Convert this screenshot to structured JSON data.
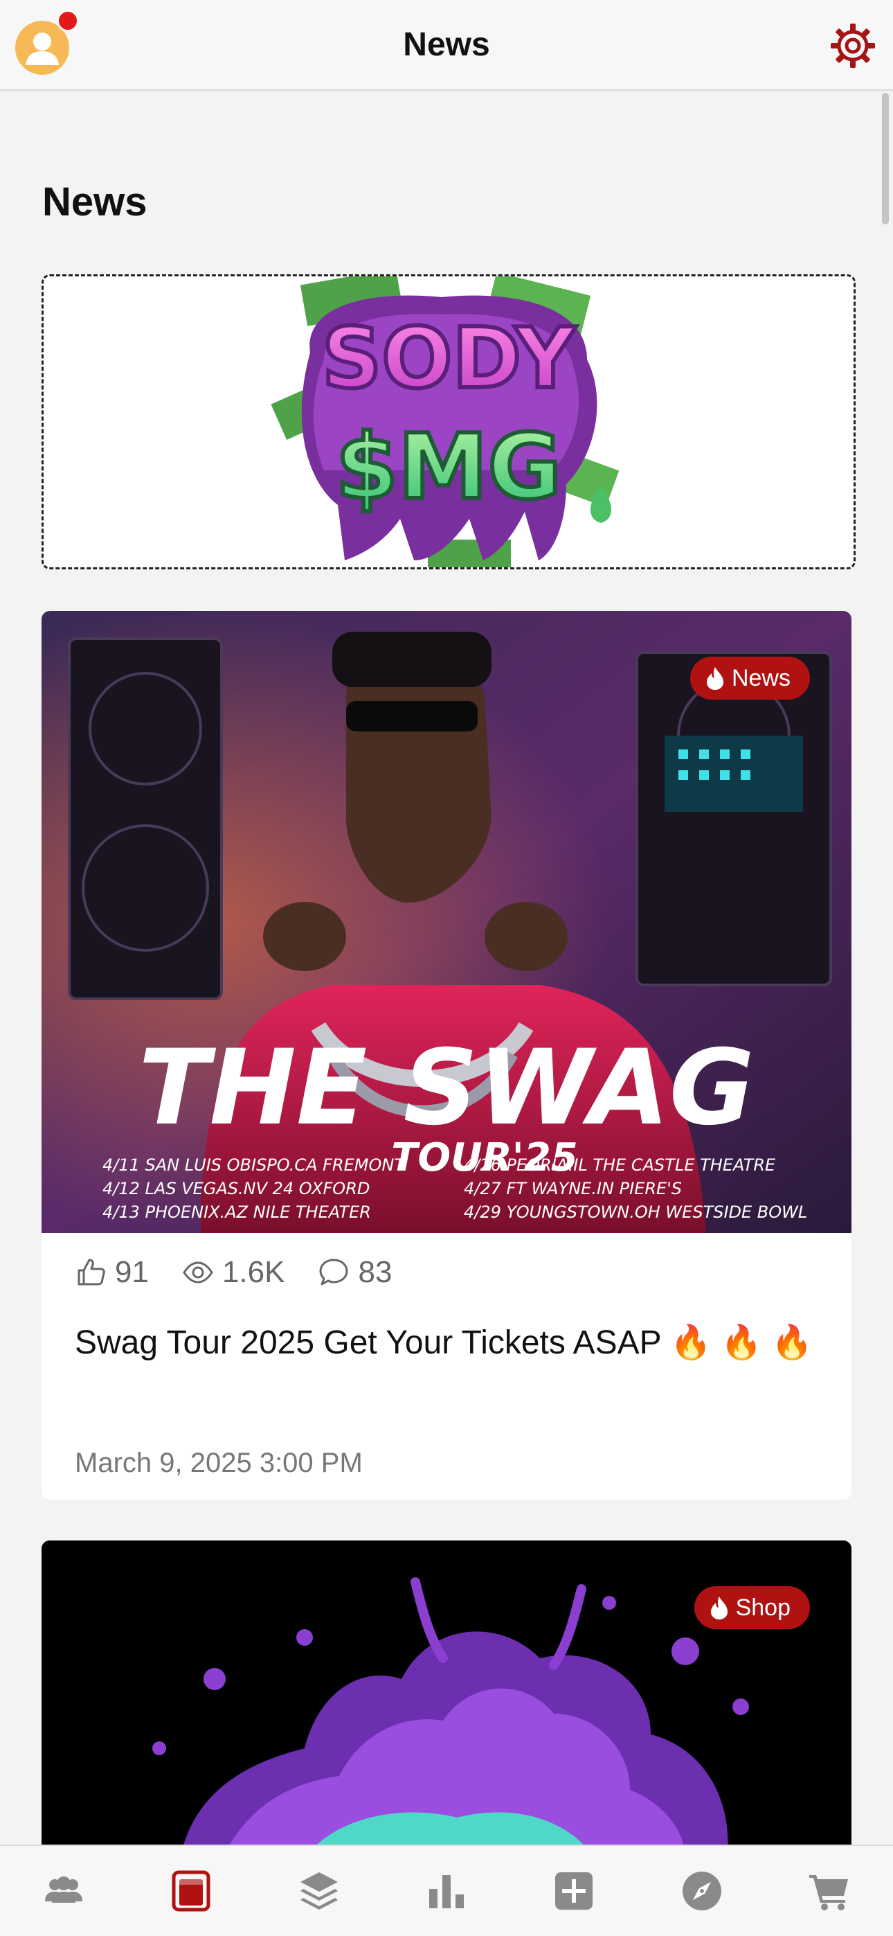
{
  "header": {
    "title": "News"
  },
  "section": {
    "title": "News"
  },
  "banner": {
    "logo_text_top": "SODY",
    "logo_text_bottom": "$MG"
  },
  "posts": [
    {
      "category": "News",
      "likes": "91",
      "views": "1.6K",
      "comments": "83",
      "title": "Swag Tour 2025 Get Your Tickets ASAP 🔥 🔥 🔥",
      "date": "March 9, 2025 3:00 PM",
      "poster_headline": "THE SWAG",
      "poster_sub": "TOUR'25",
      "tour_dates_left": [
        "4/11  SAN LUIS OBISPO.CA  FREMONT",
        "4/12  LAS VEGAS.NV  24 OXFORD",
        "4/13  PHOENIX.AZ  NILE THEATER"
      ],
      "tour_dates_right": [
        "4/26  PEORIA.IL  THE CASTLE THEATRE",
        "4/27  FT WAYNE.IN  PIERE'S",
        "4/29  YOUNGSTOWN.OH  WESTSIDE BOWL"
      ]
    },
    {
      "category": "Shop"
    }
  ],
  "colors": {
    "accent": "#b01212",
    "avatar": "#f7b955",
    "notification": "#e31818",
    "icon_gray": "#8a8a8a"
  },
  "icons": {
    "avatar": "user-avatar-icon",
    "settings": "gear-icon",
    "tabs": [
      "users-icon",
      "news-icon",
      "layers-icon",
      "chart-icon",
      "plus-icon",
      "compass-icon",
      "cart-icon"
    ]
  }
}
